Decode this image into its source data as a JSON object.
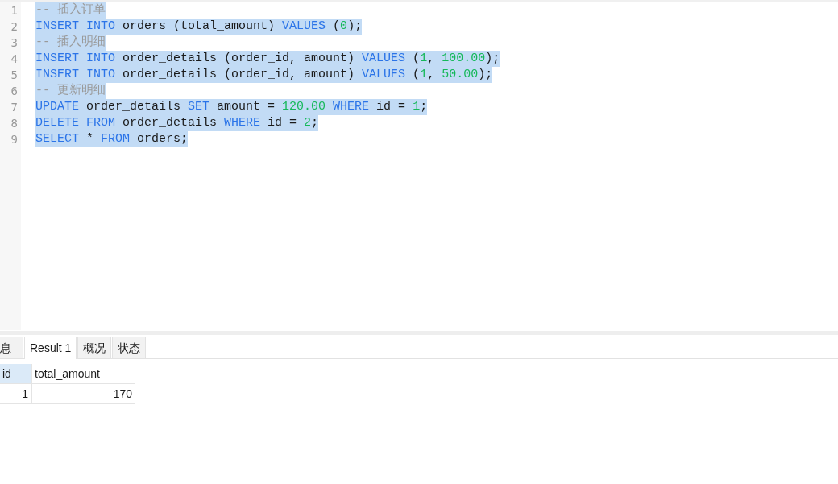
{
  "editor": {
    "lines": [
      {
        "number": "1",
        "selected": true,
        "tokens": [
          {
            "kind": "comment",
            "text": "-- 插入订单"
          }
        ]
      },
      {
        "number": "2",
        "selected": true,
        "tokens": [
          {
            "kind": "keyword",
            "text": "INSERT INTO"
          },
          {
            "kind": "plain",
            "text": " orders (total_amount) "
          },
          {
            "kind": "keyword",
            "text": "VALUES"
          },
          {
            "kind": "plain",
            "text": " ("
          },
          {
            "kind": "number",
            "text": "0"
          },
          {
            "kind": "plain",
            "text": ");"
          }
        ]
      },
      {
        "number": "3",
        "selected": true,
        "tokens": [
          {
            "kind": "comment",
            "text": "-- 插入明细"
          }
        ]
      },
      {
        "number": "4",
        "selected": true,
        "tokens": [
          {
            "kind": "keyword",
            "text": "INSERT INTO"
          },
          {
            "kind": "plain",
            "text": " order_details (order_id, amount) "
          },
          {
            "kind": "keyword",
            "text": "VALUES"
          },
          {
            "kind": "plain",
            "text": " ("
          },
          {
            "kind": "number",
            "text": "1"
          },
          {
            "kind": "plain",
            "text": ", "
          },
          {
            "kind": "number",
            "text": "100.00"
          },
          {
            "kind": "plain",
            "text": ");"
          }
        ]
      },
      {
        "number": "5",
        "selected": true,
        "tokens": [
          {
            "kind": "keyword",
            "text": "INSERT INTO"
          },
          {
            "kind": "plain",
            "text": " order_details (order_id, amount) "
          },
          {
            "kind": "keyword",
            "text": "VALUES"
          },
          {
            "kind": "plain",
            "text": " ("
          },
          {
            "kind": "number",
            "text": "1"
          },
          {
            "kind": "plain",
            "text": ", "
          },
          {
            "kind": "number",
            "text": "50.00"
          },
          {
            "kind": "plain",
            "text": ");"
          }
        ]
      },
      {
        "number": "6",
        "selected": true,
        "tokens": [
          {
            "kind": "comment",
            "text": "-- 更新明细"
          }
        ]
      },
      {
        "number": "7",
        "selected": true,
        "tokens": [
          {
            "kind": "keyword",
            "text": "UPDATE"
          },
          {
            "kind": "plain",
            "text": " order_details "
          },
          {
            "kind": "keyword",
            "text": "SET"
          },
          {
            "kind": "plain",
            "text": " amount = "
          },
          {
            "kind": "number",
            "text": "120.00"
          },
          {
            "kind": "keyword",
            "text": " WHERE"
          },
          {
            "kind": "plain",
            "text": " id = "
          },
          {
            "kind": "number",
            "text": "1"
          },
          {
            "kind": "plain",
            "text": ";"
          }
        ]
      },
      {
        "number": "8",
        "selected": true,
        "tokens": [
          {
            "kind": "keyword",
            "text": "DELETE FROM"
          },
          {
            "kind": "plain",
            "text": " order_details "
          },
          {
            "kind": "keyword",
            "text": "WHERE"
          },
          {
            "kind": "plain",
            "text": " id = "
          },
          {
            "kind": "number",
            "text": "2"
          },
          {
            "kind": "plain",
            "text": ";"
          }
        ]
      },
      {
        "number": "9",
        "selected": true,
        "tokens": [
          {
            "kind": "keyword",
            "text": "SELECT"
          },
          {
            "kind": "plain",
            "text": " * "
          },
          {
            "kind": "keyword",
            "text": "FROM"
          },
          {
            "kind": "plain",
            "text": " orders;"
          }
        ]
      }
    ]
  },
  "result_tabs": [
    {
      "label": "息",
      "selected": false
    },
    {
      "label": "Result 1",
      "selected": true
    },
    {
      "label": "概况",
      "selected": false
    },
    {
      "label": "状态",
      "selected": false
    }
  ],
  "table": {
    "columns": [
      {
        "label": "id",
        "selected": true
      },
      {
        "label": "total_amount",
        "selected": false
      }
    ],
    "rows": [
      [
        "1",
        "170"
      ]
    ]
  }
}
